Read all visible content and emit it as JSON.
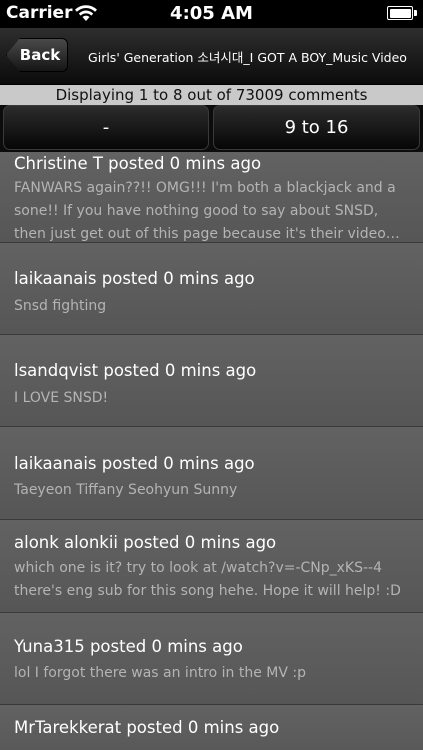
{
  "status_bar": {
    "carrier": "Carrier",
    "time": "4:05 AM"
  },
  "nav": {
    "back_label": "Back",
    "title": "Girls' Generation 소녀시대_I GOT A BOY_Music Video"
  },
  "info": {
    "text": "Displaying 1 to 8 out of 73009 comments"
  },
  "paging": {
    "prev_label": "-",
    "next_label": "9 to 16"
  },
  "comments": [
    {
      "author": "Christine T posted 0 mins ago",
      "body": "FANWARS again??!! OMG!!! I'm both a blackjack and a sone!! If you have nothing good to say about SNSD, then just get out of this page because it's their video…"
    },
    {
      "author": "laikaanais posted 0 mins ago",
      "body": "Snsd fighting"
    },
    {
      "author": "lsandqvist posted 0 mins ago",
      "body": "I LOVE SNSD!"
    },
    {
      "author": "laikaanais posted 0 mins ago",
      "body": "Taeyeon Tiffany Seohyun Sunny"
    },
    {
      "author": "alonk alonkii posted 0 mins ago",
      "body": "which one is it? try to look at /watch?v=-CNp_xKS--4 there's eng sub for this song hehe. Hope it will help! :D"
    },
    {
      "author": "Yuna315 posted 0 mins ago",
      "body": "lol I forgot there was an intro in the MV :p"
    },
    {
      "author": "MrTarekkerat posted 0 mins ago",
      "body": ""
    }
  ],
  "colors": {
    "row_bg": "#5c5c5c",
    "body_text": "#b4b4b4",
    "info_bg": "#c9c9c9"
  }
}
